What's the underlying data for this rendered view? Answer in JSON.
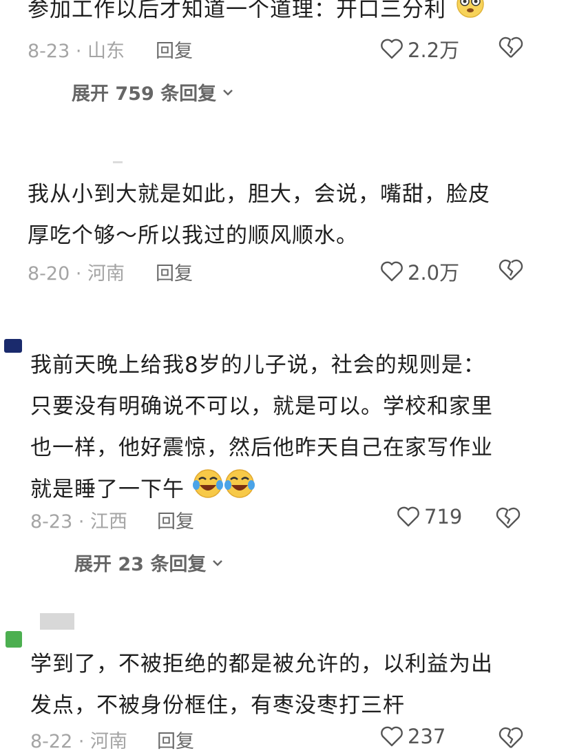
{
  "comments": [
    {
      "lines": [
        "参加工作以后才知道一个道理：开口三分利"
      ],
      "date_location": "8-23 · 山东",
      "reply_label": "回复",
      "like_count": "2.2万",
      "expand_label": "展开 759 条回复"
    },
    {
      "lines": [
        "我从小到大就是如此，胆大，会说，嘴甜，脸皮",
        "厚吃个够～所以我过的顺风顺水。"
      ],
      "date_location": "8-20 · 河南",
      "reply_label": "回复",
      "like_count": "2.0万"
    },
    {
      "lines": [
        "我前天晚上给我8岁的儿子说，社会的规则是：",
        "只要没有明确说不可以，就是可以。学校和家里",
        "也一样，他好震惊，然后他昨天自己在家写作业",
        "就是睡了一下午"
      ],
      "date_location": "8-23 · 江西",
      "reply_label": "回复",
      "like_count": "719",
      "expand_label": "展开 23 条回复"
    },
    {
      "lines": [
        "学到了，不被拒绝的都是被允许的，以利益为出",
        "发点，不被身份框住，有枣没枣打三杆"
      ],
      "date_location": "8-22 · 河南",
      "reply_label": "回复",
      "like_count": "237"
    }
  ],
  "icons": {
    "like": "heart-outline-icon",
    "dislike": "broken-heart-icon",
    "expand": "chevron-down-icon",
    "emoji_1": "nervous-face-emoji",
    "emoji_2": "crying-laughing-emoji"
  },
  "colors": {
    "text": "#1e1e1e",
    "meta": "#a4a4a4",
    "accent_avatar_1": "#1a2a6c",
    "accent_avatar_2": "#4caf50"
  }
}
